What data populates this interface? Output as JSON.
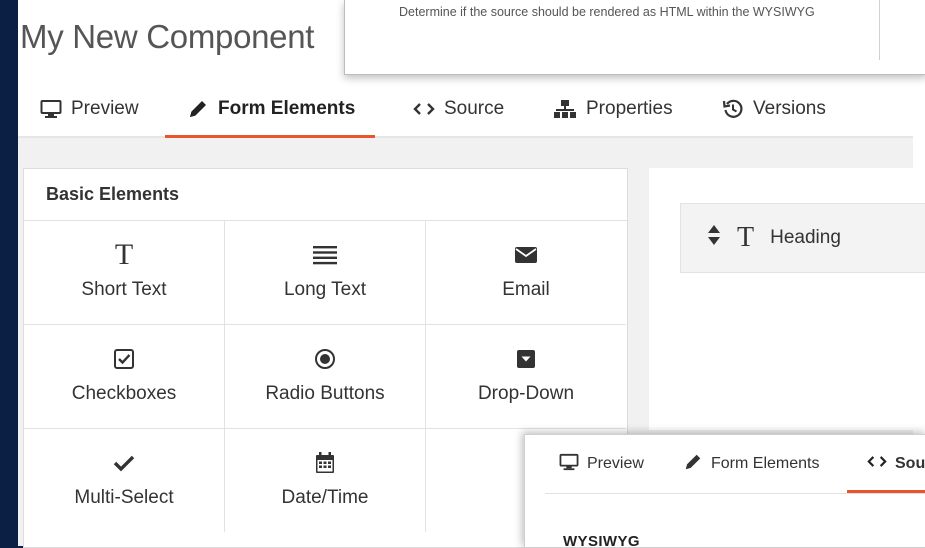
{
  "component": {
    "title": "My New Component"
  },
  "tooltip": {
    "text": "Determine if the source should be rendered as HTML within the WYSIWYG"
  },
  "tabs": [
    {
      "label": "Preview",
      "icon": "monitor-icon"
    },
    {
      "label": "Form Elements",
      "icon": "pencil-icon",
      "active": true
    },
    {
      "label": "Source",
      "icon": "code-icon"
    },
    {
      "label": "Properties",
      "icon": "sitemap-icon"
    },
    {
      "label": "Versions",
      "icon": "history-icon"
    }
  ],
  "basic_elements": {
    "title": "Basic Elements",
    "items": [
      {
        "label": "Short Text",
        "icon": "text-t-icon"
      },
      {
        "label": "Long Text",
        "icon": "text-lines-icon"
      },
      {
        "label": "Email",
        "icon": "envelope-icon"
      },
      {
        "label": "Checkboxes",
        "icon": "checkbox-icon"
      },
      {
        "label": "Radio Buttons",
        "icon": "radio-icon"
      },
      {
        "label": "Drop-Down",
        "icon": "dropdown-icon"
      },
      {
        "label": "Multi-Select",
        "icon": "checkmark-icon"
      },
      {
        "label": "Date/Time",
        "icon": "calendar-icon"
      }
    ]
  },
  "canvas": {
    "heading_label": "Heading"
  },
  "overlay": {
    "tabs": [
      {
        "label": "Preview",
        "icon": "monitor-icon"
      },
      {
        "label": "Form Elements",
        "icon": "pencil-icon"
      },
      {
        "label": "Sou",
        "icon": "code-icon",
        "active": true
      }
    ],
    "section_label": "WYSIWYG"
  },
  "colors": {
    "accent": "#e8542e",
    "frame": "#0b1f44"
  }
}
